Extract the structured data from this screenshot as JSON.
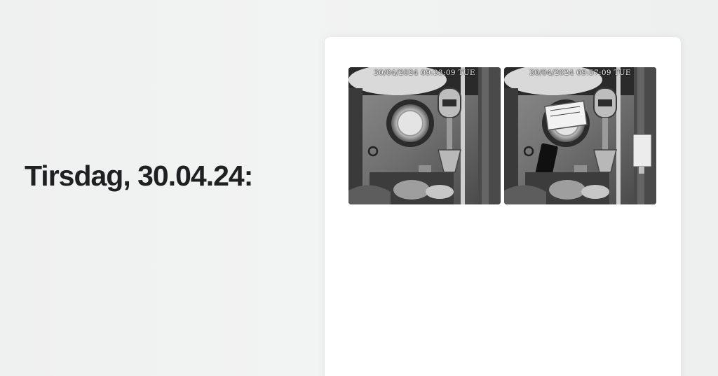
{
  "heading": "Tirsdag, 30.04.24:",
  "photos": [
    {
      "timestamp": "30/04/2024 09:33:09 TUE",
      "alt": "camera-snapshot-before"
    },
    {
      "timestamp": "30/04/2024 09:57:09 TUE",
      "alt": "camera-snapshot-after"
    }
  ],
  "colors": {
    "background": "#f0f1f1",
    "card": "#ffffff",
    "heading": "#1f2022"
  }
}
